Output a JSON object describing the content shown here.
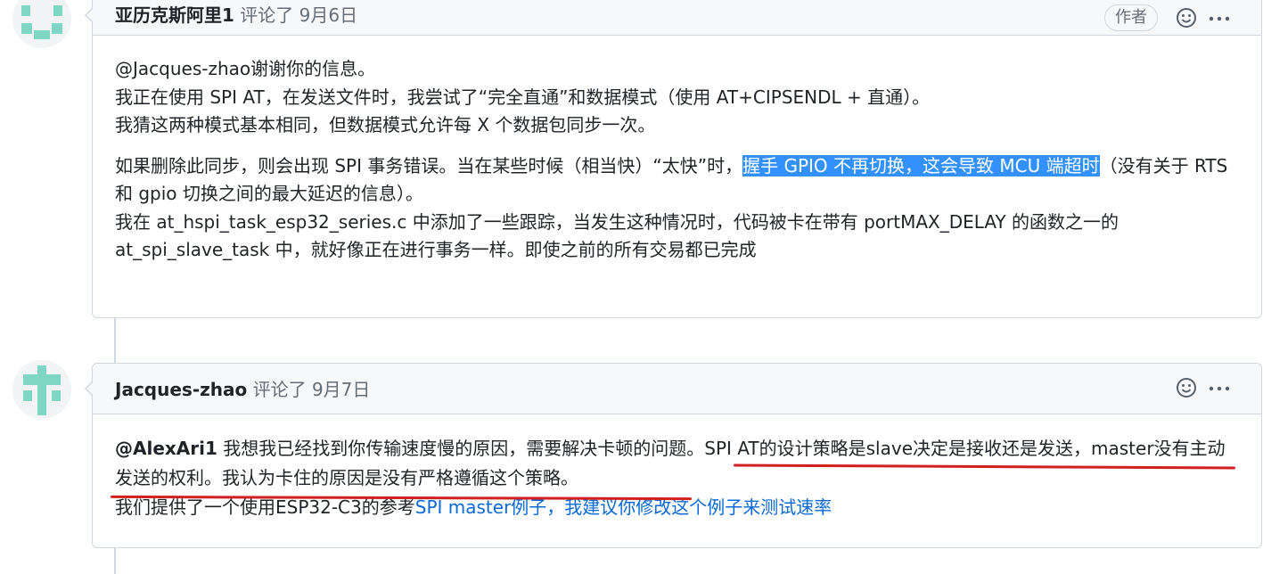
{
  "comments": [
    {
      "author": "亚历克斯阿里1",
      "action": "评论了",
      "date": "9月6日",
      "badge": "作者",
      "p1": "@Jacques-zhao谢谢你的信息。",
      "p2": "我正在使用 SPI AT，在发送文件时，我尝试了“完全直通”和数据模式（使用 AT+CIPSENDL + 直通）。",
      "p3": "我猜这两种模式基本相同，但数据模式允许每 X 个数据包同步一次。",
      "p4a": "如果删除此同步，则会出现 SPI 事务错误。当在某些时候（相当快）“太快”时，",
      "p4hl": "握手 GPIO 不再切换，这会导致 MCU 端超时",
      "p4b": "（没有关于 RTS 和 gpio 切换之间的最大延迟的信息）。",
      "p5": "我在 at_hspi_task_esp32_series.c 中添加了一些跟踪，当发生这种情况时，代码被卡在带有 portMAX_DELAY 的函数之一的 at_spi_slave_task 中，就好像正在进行事务一样。即使之前的所有交易都已完成"
    },
    {
      "author": "Jacques-zhao",
      "action": "评论了",
      "date": "9月7日",
      "mention": "@AlexAri1",
      "p1a": " 我想我已经找到你传输速度慢的原因，需要解决卡顿的问题。SPI AT的设计策略是slave决定是接收还是发送，master没有主动发送的权利。我认为卡住的原因是没有严格遵循这个策略。",
      "p2a": "我们提供了一个使用ESP32-C3的参考",
      "p2link": "SPI master例子，我建议你修改这个例子来测试速率"
    }
  ],
  "icons": {
    "reaction": "smiley-icon",
    "menu": "kebab-icon"
  },
  "colors": {
    "highlight": "#3390ff",
    "link": "#0969da",
    "underline": "#d21f1f"
  }
}
